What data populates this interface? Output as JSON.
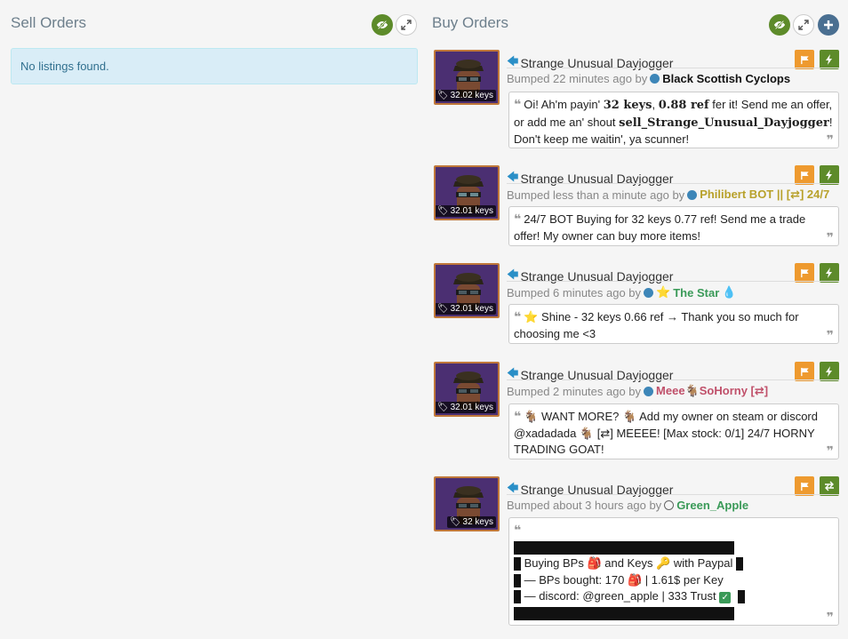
{
  "sell": {
    "title": "Sell Orders",
    "empty_text": "No listings found."
  },
  "buy": {
    "title": "Buy Orders"
  },
  "icons": {
    "eye": "eye-slash-icon",
    "expand": "expand-icon",
    "add": "plus-icon",
    "flag": "flag-icon",
    "bolt": "bolt-icon",
    "swap": "exchange-icon",
    "tag": "tag-icon",
    "arrow": "arrow-left-icon"
  },
  "colors": {
    "green": "#5d8b2a",
    "orange": "#ee9a2f",
    "item_border": "#c0783a",
    "item_bg": "#4b2f72"
  },
  "orders": [
    {
      "item": "Strange Unusual Dayjogger",
      "price": "32.02 keys",
      "bumped": "Bumped 22 minutes ago by",
      "user": "Black Scottish Cyclops",
      "user_color": "#111111",
      "msg_a": "Oi! Ah'm payin' ",
      "msg_b": "32 keys",
      "msg_c": ", ",
      "msg_d": "0.88 ref",
      "msg_e": " fer it! Send me an offer, or add me an' shout ",
      "msg_f": "sell_Strange_Unusual_Dayjogger",
      "msg_g": "! Don't keep me waitin', ya scunner!"
    },
    {
      "item": "Strange Unusual Dayjogger",
      "price": "32.01 keys",
      "bumped": "Bumped less than a minute ago by",
      "user": "Philibert BOT || [⇄] 24/7",
      "user_color": "#b8a12b",
      "msg": "24/7 BOT Buying for 32 keys 0.77 ref! Send me a trade offer! My owner can buy more items!"
    },
    {
      "item": "Strange Unusual Dayjogger",
      "price": "32.01 keys",
      "bumped": "Bumped 6 minutes ago by",
      "user": "The Star",
      "user_color": "#3a9a58",
      "msg": "Shine - 32 keys 0.66 ref → Thank you so much for choosing me <3"
    },
    {
      "item": "Strange Unusual Dayjogger",
      "price": "32.01 keys",
      "bumped": "Bumped 2 minutes ago by",
      "user_a": "Meee",
      "user_b": "SoHorny [⇄]",
      "user_color": "#c0506a",
      "msg_a": " WANT MORE? ",
      "msg_b": " Add my owner on steam or discord @xadadada ",
      "msg_c": " [⇄] MEEEE! [Max stock: 0/1] 24/7 HORNY TRADING GOAT!"
    },
    {
      "item": "Strange Unusual Dayjogger",
      "price": "32 keys",
      "bumped": "Bumped about 3 hours ago by",
      "user": "Green_Apple",
      "user_color": "#3a9a58",
      "line1_a": " Buying BPs ",
      "line1_b": " and Keys ",
      "line1_c": " with Paypal ",
      "line2_a": " — BPs bought: 170 ",
      "line2_b": " | 1.61$ per Key",
      "line3": " — discord: @green_apple | 333 Trust "
    }
  ]
}
